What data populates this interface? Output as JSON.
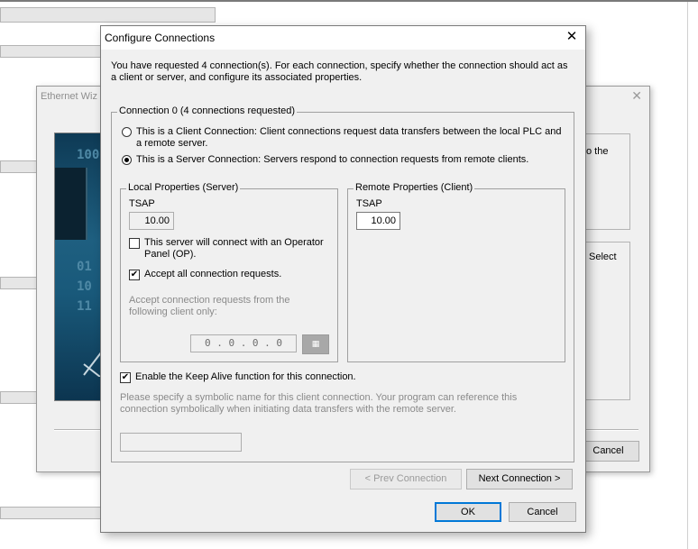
{
  "background_window": {
    "title": "Ethernet Wiz",
    "side_text_1": "o the",
    "side_text_2": "Select",
    "cancel_label": "Cancel",
    "image_digits": [
      "100",
      "01",
      "10",
      "11"
    ]
  },
  "dialog": {
    "title": "Configure Connections",
    "close_glyph": "✕",
    "intro": "You have requested 4 connection(s).  For each connection, specify whether the connection should act as a client or server, and configure its associated properties.",
    "connection_group": {
      "title": "Connection 0 (4 connections requested)",
      "client_option": "This is a Client Connection: Client connections request data transfers between the local PLC and a remote server.",
      "server_option": "This is a Server Connection: Servers respond to connection requests from remote clients.",
      "selected": "server"
    },
    "local": {
      "title": "Local Properties (Server)",
      "tsap_label": "TSAP",
      "tsap_value": "10.00",
      "op_panel_label": "This server will connect with an Operator Panel (OP).",
      "op_panel_checked": false,
      "accept_all_label": "Accept all connection requests.",
      "accept_all_checked": true,
      "accept_from_label": "Accept connection requests from the following client only:",
      "ip_value": "0  .  0  .  0  .  0",
      "ip_button_glyph": "▦"
    },
    "remote": {
      "title": "Remote Properties (Client)",
      "tsap_label": "TSAP",
      "tsap_value": "10.00"
    },
    "keep_alive_label": "Enable the Keep Alive function for this connection.",
    "keep_alive_checked": true,
    "symbolic_text": "Please specify a symbolic name for this client connection.  Your program can reference this connection symbolically when initiating data transfers with the remote server.",
    "symbolic_value": "",
    "buttons": {
      "prev": "< Prev Connection",
      "next": "Next Connection >",
      "ok": "OK",
      "cancel": "Cancel"
    },
    "check_glyph": "✔"
  }
}
